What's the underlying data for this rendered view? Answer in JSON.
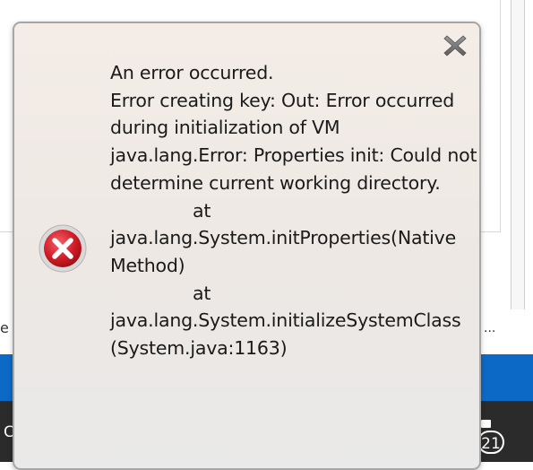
{
  "background": {
    "left_text": "e",
    "ellipsis": "...",
    "taskbar_left_text": "C",
    "notification_count": "21"
  },
  "error_popup": {
    "message_lines": [
      "An error occurred.",
      "Error creating key: Out: Error occurred",
      "during initialization of VM",
      "java.lang.Error: Properties init: Could not",
      "determine current working directory.",
      "at",
      "java.lang.System.initProperties(Native",
      "Method)",
      "at",
      "java.lang.System.initializeSystemClass",
      "(System.java:1163)"
    ],
    "icons": {
      "close": "close-icon",
      "error": "error-icon"
    },
    "colors": {
      "error_red": "#c4161c",
      "close_gray": "#7a7a7a"
    }
  }
}
